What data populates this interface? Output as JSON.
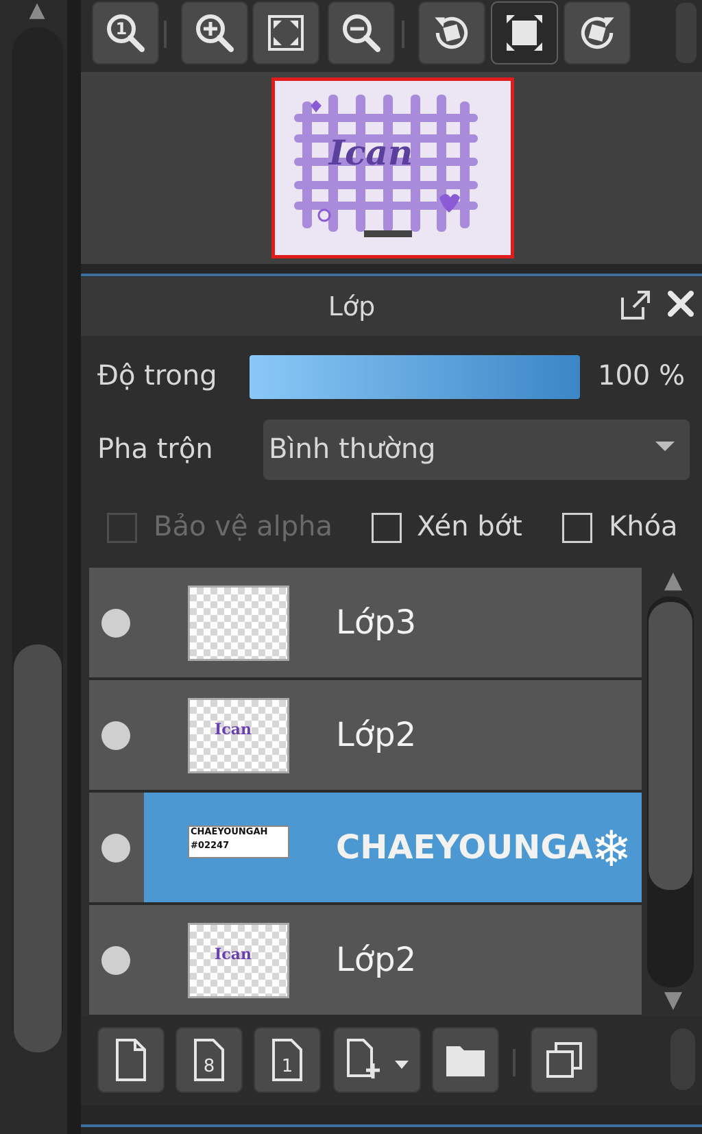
{
  "navigator": {
    "toolbar": [
      {
        "id": "zoom-actual",
        "icon": "zoom-actual-size-icon"
      },
      {
        "id": "zoom-in",
        "icon": "zoom-in-icon"
      },
      {
        "id": "fit-window",
        "icon": "fit-to-window-icon"
      },
      {
        "id": "zoom-out",
        "icon": "zoom-out-icon"
      },
      {
        "id": "rotate-left",
        "icon": "rotate-left-icon"
      },
      {
        "id": "fit-rotate-reset",
        "icon": "fit-reset-icon",
        "active": true
      },
      {
        "id": "rotate-right",
        "icon": "rotate-right-icon"
      }
    ],
    "preview_word": "Ican",
    "frame_color": "#e01b1b"
  },
  "layer_panel": {
    "title": "Lớp",
    "opacity_label": "Độ trong",
    "opacity_value": "100 %",
    "opacity_level": 1.0,
    "blend_label": "Pha trộn",
    "blend_value": "Bình thường",
    "alpha_protect_label": "Bảo vệ alpha",
    "clipping_label": "Xén bớt",
    "lock_label": "Khóa",
    "accent_color": "#4b98d2",
    "layers": [
      {
        "name": "Lớp3",
        "thumb": "empty",
        "selected": false
      },
      {
        "name": "Lớp2",
        "thumb": "text",
        "thumb_text": "Ican",
        "selected": false
      },
      {
        "name": "CHAEYOUNGA",
        "thumb": "banner",
        "thumb_text_1": "CHAEYOUNGAH",
        "thumb_text_2": "#02247",
        "selected": true,
        "badge_icon": "snowflake-icon"
      },
      {
        "name": "Lớp2",
        "thumb": "text",
        "thumb_text": "Ican",
        "selected": false
      }
    ]
  },
  "bottom_toolbar": [
    {
      "id": "new-layer",
      "icon": "new-layer-icon"
    },
    {
      "id": "new-8bit-layer",
      "icon": "new-8bit-layer-icon"
    },
    {
      "id": "new-1bit-layer",
      "icon": "new-1bit-layer-icon"
    },
    {
      "id": "add-layer-menu",
      "icon": "add-layer-dropdown-icon"
    },
    {
      "id": "new-folder",
      "icon": "folder-icon"
    },
    {
      "id": "duplicate-layer",
      "icon": "duplicate-layer-icon"
    }
  ]
}
